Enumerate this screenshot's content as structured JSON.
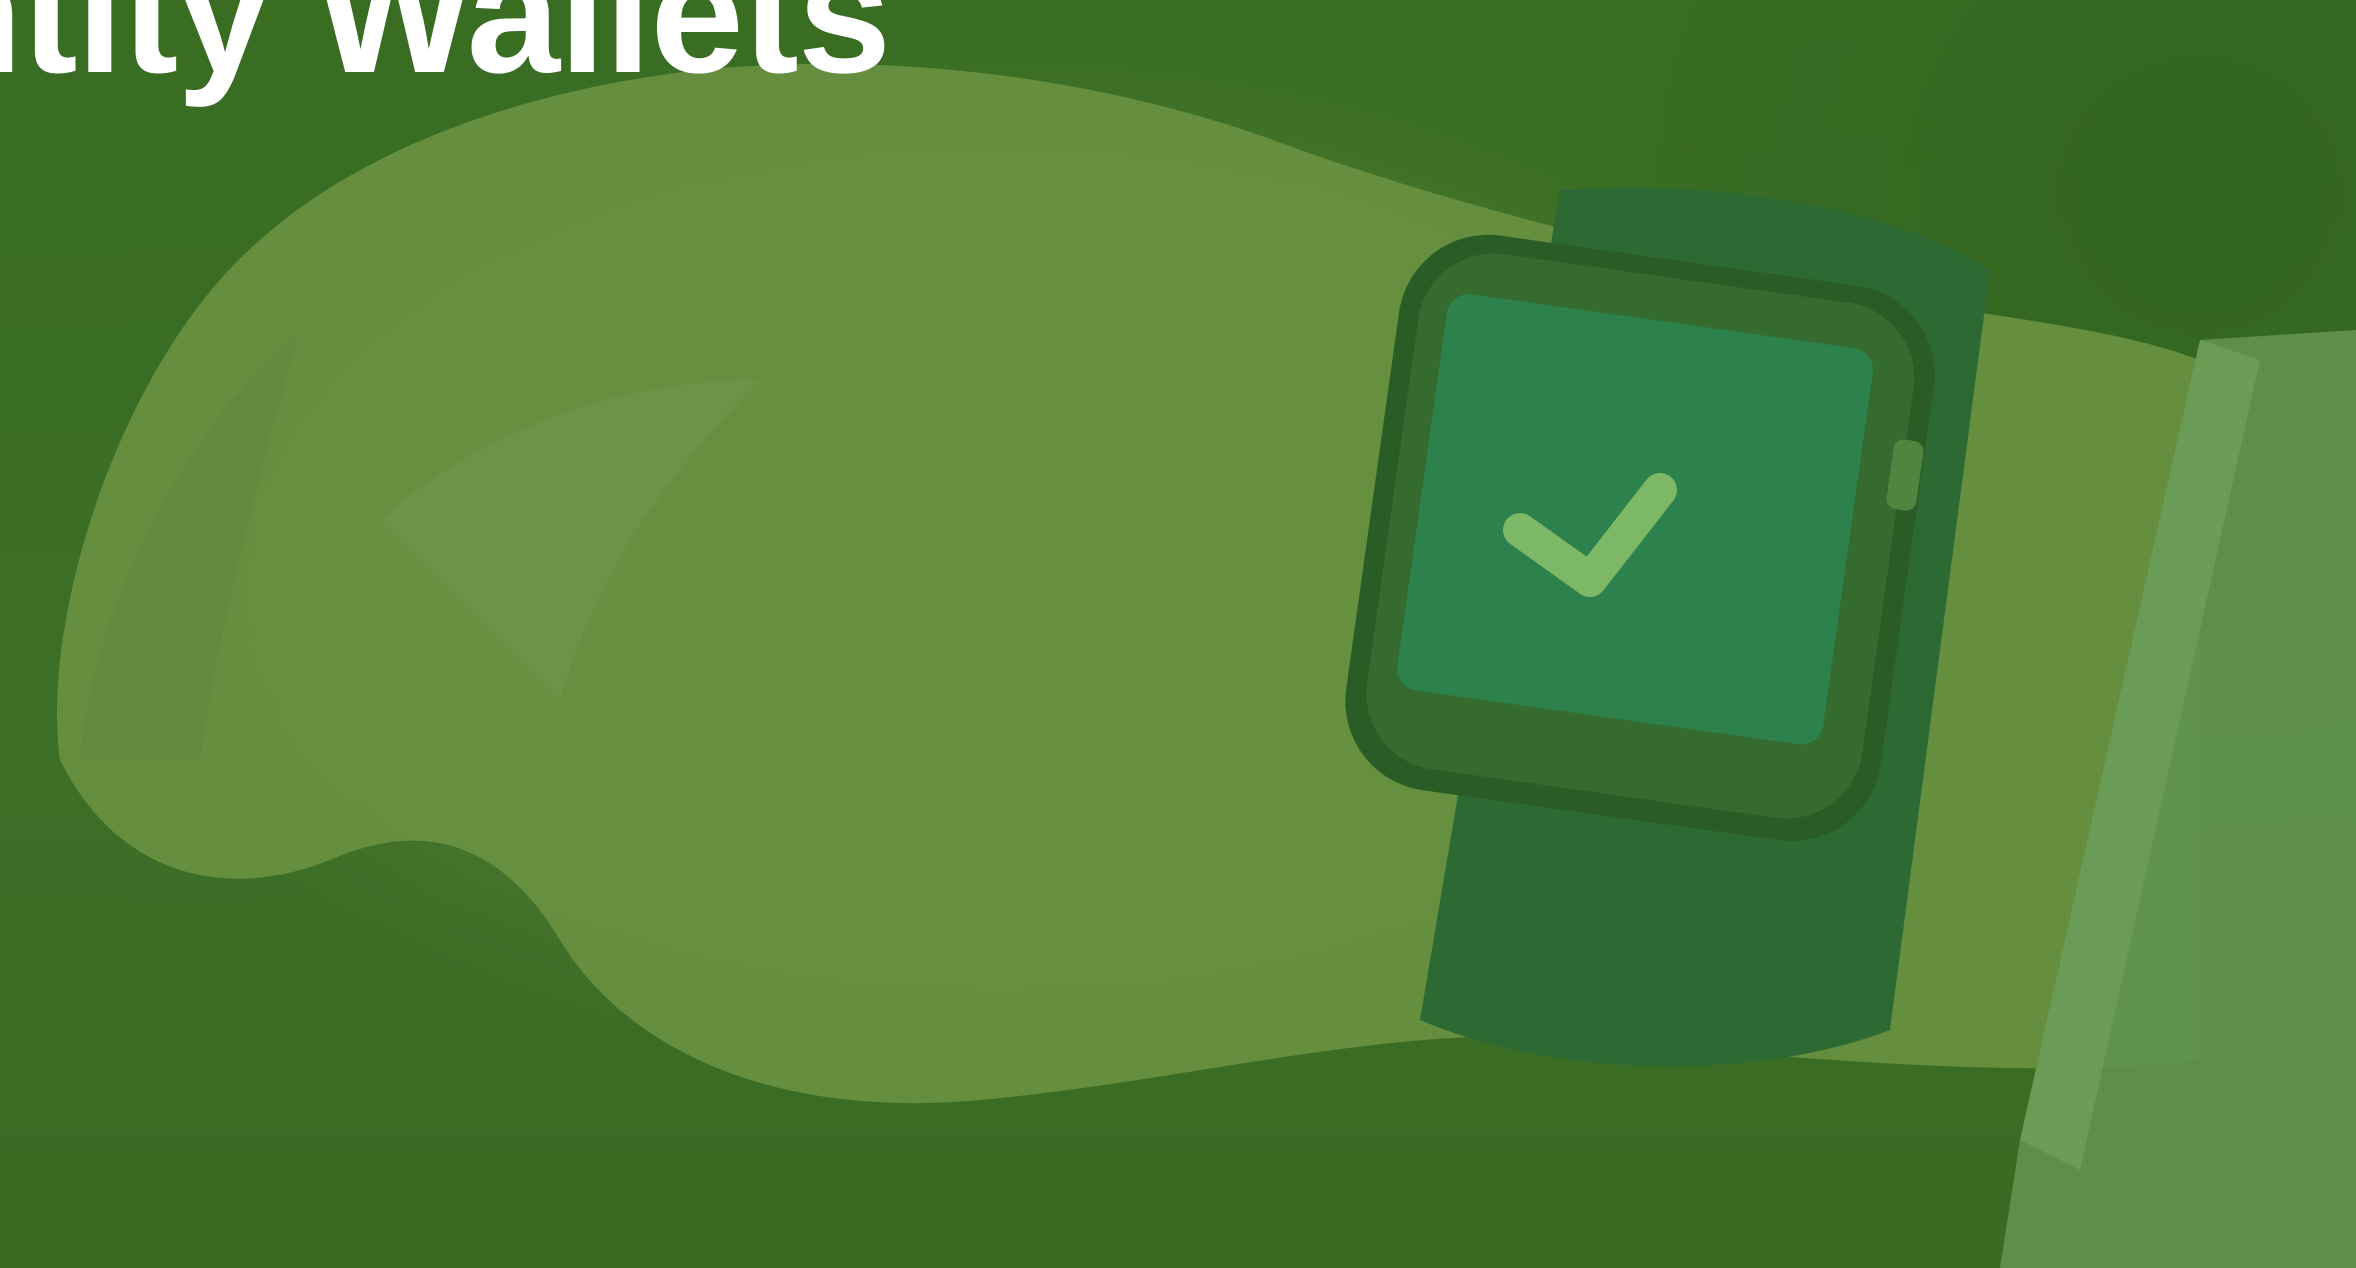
{
  "hero": {
    "title": "ntity Wallets",
    "image_icon": "checkmark-icon",
    "overlay_color": "#2e6b1c"
  },
  "colors": {
    "background": "#3a6b22",
    "skin": "#7a9a50",
    "strap": "#2f6b3a",
    "screen": "#2e8a5a",
    "check": "#8fc878",
    "sleeve": "#7aa668",
    "title_text": "#ffffff"
  }
}
